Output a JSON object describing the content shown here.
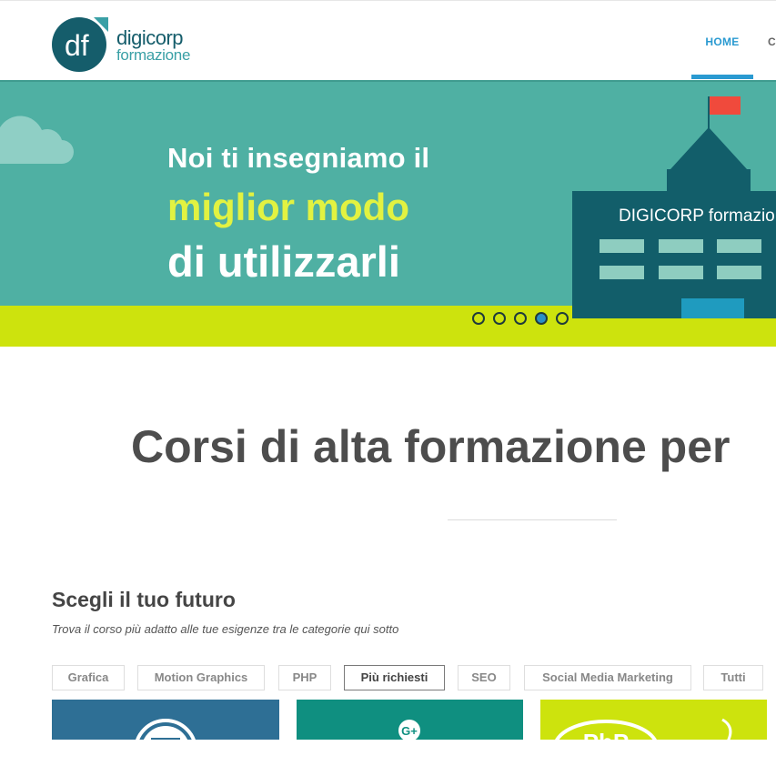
{
  "header": {
    "logo": {
      "mark": "df",
      "line1": "digicorp",
      "line2": "formazione"
    },
    "nav": [
      {
        "label": "HOME",
        "active": true
      },
      {
        "label": "C"
      }
    ]
  },
  "hero": {
    "line1": "Noi ti insegniamo il",
    "line2": "miglior modo",
    "line3": "di utilizzarli",
    "building_label": "DIGICORP formazio",
    "slides": 5,
    "active_slide": 4,
    "colors": {
      "sky": "#4fb0a3",
      "ground": "#cde30d",
      "highlight_text": "#e2f241",
      "building": "#125e6a",
      "flag": "#f04a3c"
    }
  },
  "main": {
    "title": "Corsi di alta formazione per",
    "section_title": "Scegli il tuo futuro",
    "section_desc": "Trova il corso più adatto alle tue esigenze tra le categorie qui sotto",
    "filters": [
      {
        "label": "Grafica"
      },
      {
        "label": "Motion Graphics"
      },
      {
        "label": "PHP"
      },
      {
        "label": "Più richiesti",
        "active": true
      },
      {
        "label": "SEO"
      },
      {
        "label": "Social Media Marketing"
      },
      {
        "label": "Tutti"
      }
    ]
  },
  "cards": [
    {
      "icon": "wordpress-icon",
      "color": "#2e6f95"
    },
    {
      "icon": "google-plus-icon",
      "icon_text": "G+",
      "color": "#0f8f80"
    },
    {
      "icon": "php-icon",
      "icon_text": "PhP",
      "color": "#cde30d"
    }
  ]
}
